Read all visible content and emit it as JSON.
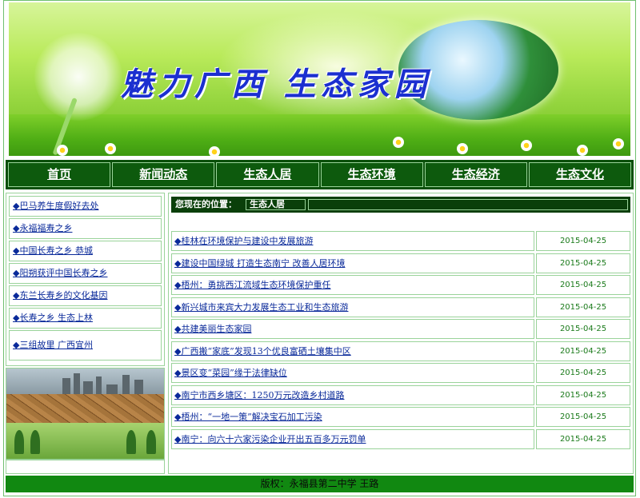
{
  "banner": {
    "title": "魅力广西 生态家园"
  },
  "nav": {
    "items": [
      {
        "label": "首页"
      },
      {
        "label": "新闻动态"
      },
      {
        "label": "生态人居"
      },
      {
        "label": "生态环境"
      },
      {
        "label": "生态经济"
      },
      {
        "label": "生态文化"
      }
    ]
  },
  "sidebar": {
    "links": [
      {
        "label": "◆巴马养生度假好去处"
      },
      {
        "label": "◆永福福寿之乡"
      },
      {
        "label": "◆中国长寿之乡 恭城"
      },
      {
        "label": "◆阳朔获评中国长寿之乡"
      },
      {
        "label": "◆东兰长寿乡的文化基因"
      },
      {
        "label": "◆长寿之乡 生态上林"
      },
      {
        "label": "◆三组故里 广西宜州"
      }
    ]
  },
  "location": {
    "label": "您现在的位置：",
    "value": "生态人居"
  },
  "news": [
    {
      "title": "◆桂林在环境保护与建设中发展旅游",
      "date": "2015-04-25"
    },
    {
      "title": "◆建设中国绿城 打造生态南宁 改善人居环境",
      "date": "2015-04-25"
    },
    {
      "title": "◆梧州：勇挑西江流域生态环境保护重任",
      "date": "2015-04-25"
    },
    {
      "title": "◆新兴城市来宾大力发展生态工业和生态旅游",
      "date": "2015-04-25"
    },
    {
      "title": "◆共建美丽生态家园",
      "date": "2015-04-25"
    },
    {
      "title": "◆广西搬“家底”发现13个优良富硒土壤集中区",
      "date": "2015-04-25"
    },
    {
      "title": "◆景区变“菜园”缘于法律缺位",
      "date": "2015-04-25"
    },
    {
      "title": "◆南宁市西乡塘区：1250万元改造乡村道路",
      "date": "2015-04-25"
    },
    {
      "title": "◆梧州：“一地一策”解决宝石加工污染",
      "date": "2015-04-25"
    },
    {
      "title": "◆南宁：向六十六家污染企业开出五百多万元罚单",
      "date": "2015-04-25"
    }
  ],
  "footer": {
    "text": "版权：永福县第二中学 王路"
  },
  "colors": {
    "nav_bg": "#0a4f0a",
    "footer_bg": "#118811",
    "border": "#9ad39a",
    "link": "#0a2a9a",
    "date": "#1a7a1a"
  }
}
